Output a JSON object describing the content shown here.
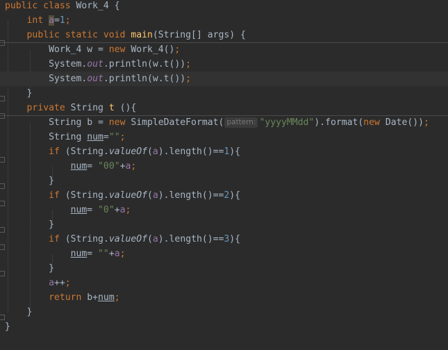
{
  "editor": {
    "lines": [
      {
        "tokens": [
          {
            "t": "public class ",
            "c": "kw"
          },
          {
            "t": "Work_4 {",
            "c": ""
          }
        ]
      },
      {
        "tokens": [
          {
            "t": "    ",
            "c": ""
          },
          {
            "t": "int ",
            "c": "kw"
          },
          {
            "t": "a",
            "c": "fld hl"
          },
          {
            "t": "=",
            "c": ""
          },
          {
            "t": "1",
            "c": "num"
          },
          {
            "t": ";",
            "c": "kw"
          }
        ]
      },
      {
        "tokens": [
          {
            "t": "    ",
            "c": ""
          },
          {
            "t": "public static void ",
            "c": "kw"
          },
          {
            "t": "main",
            "c": "fn"
          },
          {
            "t": "(String[] args) {",
            "c": ""
          }
        ]
      },
      {
        "tokens": [
          {
            "t": "        ",
            "c": ""
          },
          {
            "t": "Work_4 w = ",
            "c": ""
          },
          {
            "t": "new ",
            "c": "kw"
          },
          {
            "t": "Work_4()",
            "c": ""
          },
          {
            "t": ";",
            "c": "kw"
          }
        ]
      },
      {
        "tokens": [
          {
            "t": "        ",
            "c": ""
          },
          {
            "t": "System.",
            "c": ""
          },
          {
            "t": "out",
            "c": "fld-i"
          },
          {
            "t": ".println(w.t())",
            "c": ""
          },
          {
            "t": ";",
            "c": "kw"
          }
        ]
      },
      {
        "tokens": [
          {
            "t": "        ",
            "c": ""
          },
          {
            "t": "System.",
            "c": ""
          },
          {
            "t": "out",
            "c": "fld-i"
          },
          {
            "t": ".println(w.t())",
            "c": ""
          },
          {
            "t": ";",
            "c": "kw"
          }
        ]
      },
      {
        "tokens": [
          {
            "t": "    }",
            "c": ""
          }
        ]
      },
      {
        "tokens": [
          {
            "t": "    ",
            "c": ""
          },
          {
            "t": "private ",
            "c": "kw"
          },
          {
            "t": "String ",
            "c": ""
          },
          {
            "t": "t ",
            "c": "fn"
          },
          {
            "t": "(){",
            "c": ""
          }
        ]
      },
      {
        "tokens": [
          {
            "t": "        ",
            "c": ""
          },
          {
            "t": "String b = ",
            "c": ""
          },
          {
            "t": "new ",
            "c": "kw"
          },
          {
            "t": "SimpleDateFormat(",
            "c": ""
          },
          {
            "t": "pattern:",
            "c": "hint"
          },
          {
            "t": "\"yyyyMMdd\"",
            "c": "str"
          },
          {
            "t": ").format(",
            "c": ""
          },
          {
            "t": "new ",
            "c": "kw"
          },
          {
            "t": "Date())",
            "c": ""
          },
          {
            "t": ";",
            "c": "kw"
          }
        ]
      },
      {
        "tokens": [
          {
            "t": "        ",
            "c": ""
          },
          {
            "t": "String ",
            "c": ""
          },
          {
            "t": "num",
            "c": "u"
          },
          {
            "t": "=",
            "c": ""
          },
          {
            "t": "\"\"",
            "c": "str"
          },
          {
            "t": ";",
            "c": "kw"
          }
        ]
      },
      {
        "tokens": [
          {
            "t": "        ",
            "c": ""
          },
          {
            "t": "if ",
            "c": "kw"
          },
          {
            "t": "(String.",
            "c": ""
          },
          {
            "t": "valueOf",
            "c": "it"
          },
          {
            "t": "(",
            "c": ""
          },
          {
            "t": "a",
            "c": "fld"
          },
          {
            "t": ").length()==",
            "c": ""
          },
          {
            "t": "1",
            "c": "num"
          },
          {
            "t": "){",
            "c": ""
          }
        ]
      },
      {
        "tokens": [
          {
            "t": "            ",
            "c": ""
          },
          {
            "t": "num",
            "c": "u"
          },
          {
            "t": "= ",
            "c": ""
          },
          {
            "t": "\"00\"",
            "c": "str"
          },
          {
            "t": "+",
            "c": ""
          },
          {
            "t": "a",
            "c": "fld"
          },
          {
            "t": ";",
            "c": "kw"
          }
        ]
      },
      {
        "tokens": [
          {
            "t": "        }",
            "c": ""
          }
        ]
      },
      {
        "tokens": [
          {
            "t": "        ",
            "c": ""
          },
          {
            "t": "if ",
            "c": "kw"
          },
          {
            "t": "(String.",
            "c": ""
          },
          {
            "t": "valueOf",
            "c": "it"
          },
          {
            "t": "(",
            "c": ""
          },
          {
            "t": "a",
            "c": "fld"
          },
          {
            "t": ").length()==",
            "c": ""
          },
          {
            "t": "2",
            "c": "num"
          },
          {
            "t": "){",
            "c": ""
          }
        ]
      },
      {
        "tokens": [
          {
            "t": "            ",
            "c": ""
          },
          {
            "t": "num",
            "c": "u"
          },
          {
            "t": "= ",
            "c": ""
          },
          {
            "t": "\"0\"",
            "c": "str"
          },
          {
            "t": "+",
            "c": ""
          },
          {
            "t": "a",
            "c": "fld"
          },
          {
            "t": ";",
            "c": "kw"
          }
        ]
      },
      {
        "tokens": [
          {
            "t": "        }",
            "c": ""
          }
        ]
      },
      {
        "tokens": [
          {
            "t": "        ",
            "c": ""
          },
          {
            "t": "if ",
            "c": "kw"
          },
          {
            "t": "(String.",
            "c": ""
          },
          {
            "t": "valueOf",
            "c": "it"
          },
          {
            "t": "(",
            "c": ""
          },
          {
            "t": "a",
            "c": "fld"
          },
          {
            "t": ").length()==",
            "c": ""
          },
          {
            "t": "3",
            "c": "num"
          },
          {
            "t": "){",
            "c": ""
          }
        ]
      },
      {
        "tokens": [
          {
            "t": "            ",
            "c": ""
          },
          {
            "t": "num",
            "c": "u"
          },
          {
            "t": "= ",
            "c": ""
          },
          {
            "t": "\"\"",
            "c": "str"
          },
          {
            "t": "+",
            "c": ""
          },
          {
            "t": "a",
            "c": "fld"
          },
          {
            "t": ";",
            "c": "kw"
          }
        ]
      },
      {
        "tokens": [
          {
            "t": "        }",
            "c": ""
          }
        ]
      },
      {
        "tokens": [
          {
            "t": "        ",
            "c": ""
          },
          {
            "t": "a",
            "c": "fld"
          },
          {
            "t": "++",
            "c": ""
          },
          {
            "t": ";",
            "c": "kw"
          }
        ]
      },
      {
        "tokens": [
          {
            "t": "        ",
            "c": ""
          },
          {
            "t": "return ",
            "c": "kw"
          },
          {
            "t": "b+",
            "c": ""
          },
          {
            "t": "num",
            "c": "u"
          },
          {
            "t": ";",
            "c": "kw"
          }
        ]
      },
      {
        "tokens": [
          {
            "t": "    }",
            "c": ""
          }
        ]
      },
      {
        "tokens": [
          {
            "t": "}",
            "c": ""
          }
        ]
      }
    ]
  }
}
